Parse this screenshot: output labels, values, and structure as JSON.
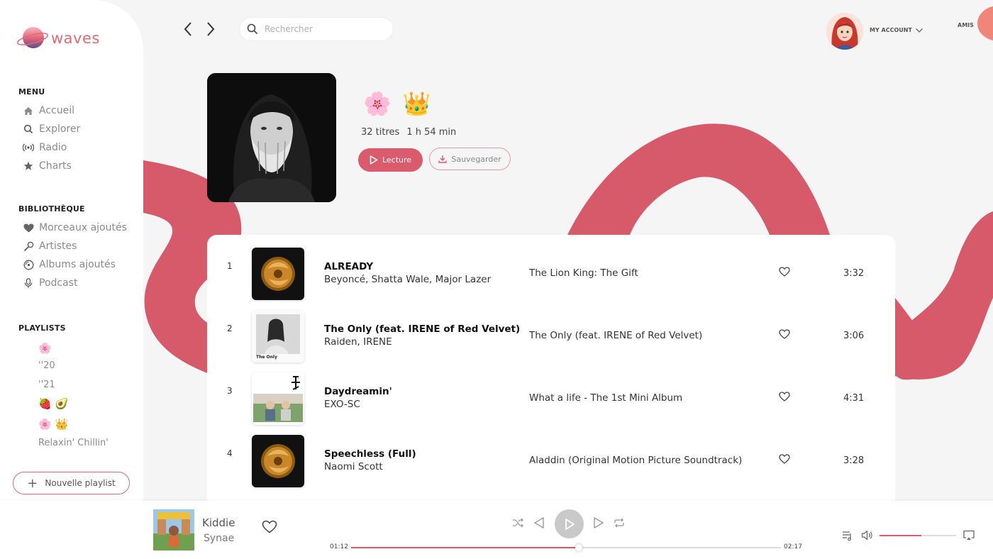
{
  "app": {
    "logo_text": "waves",
    "accent": "#d95b6c"
  },
  "search": {
    "placeholder": "Rechercher"
  },
  "account": {
    "label": "MY ACCOUNT",
    "friends_label": "AMIS"
  },
  "sidebar": {
    "menu_title": "MENU",
    "menu": [
      {
        "label": "Accueil",
        "icon": "home-icon"
      },
      {
        "label": "Explorer",
        "icon": "search-icon"
      },
      {
        "label": "Radio",
        "icon": "radio-icon"
      },
      {
        "label": "Charts",
        "icon": "star-icon"
      }
    ],
    "library_title": "BIBLIOTHÈQUE",
    "library": [
      {
        "label": "Morceaux ajoutés",
        "icon": "heart-icon"
      },
      {
        "label": "Artistes",
        "icon": "microphone-icon"
      },
      {
        "label": "Albums ajoutés",
        "icon": "disc-icon"
      },
      {
        "label": "Podcast",
        "icon": "podcast-mic-icon"
      }
    ],
    "playlists_title": "PLAYLISTS",
    "playlists": [
      {
        "label": "",
        "emoji": [
          "🌸"
        ]
      },
      {
        "label": "''20"
      },
      {
        "label": "''21"
      },
      {
        "label": "",
        "emoji": [
          "🍓",
          "🥑"
        ]
      },
      {
        "label": "",
        "emoji": [
          "🌸",
          "👑"
        ]
      },
      {
        "label": "Relaxin' Chillin'"
      }
    ],
    "new_playlist": "Nouvelle playlist"
  },
  "playlist": {
    "emoji": [
      "🌸",
      "👑"
    ],
    "track_count": "32 titres",
    "duration": "1 h 54 min",
    "play_label": "Lecture",
    "save_label": "Sauvegarder"
  },
  "tracks": [
    {
      "num": "1",
      "title": "ALREADY",
      "artist": "Beyoncé, Shatta Wale, Major Lazer",
      "album": "The Lion King: The Gift",
      "duration": "3:32"
    },
    {
      "num": "2",
      "title": "The Only (feat. IRENE of Red Velvet)",
      "artist": "Raiden, IRENE",
      "album": "The Only (feat. IRENE of Red Velvet)",
      "duration": "3:06",
      "cover_caption": "The Only"
    },
    {
      "num": "3",
      "title": "Daydreamin'",
      "artist": "EXO-SC",
      "album": "What a life - The 1st Mini Album",
      "duration": "4:31"
    },
    {
      "num": "4",
      "title": "Speechless (Full)",
      "artist": "Naomi Scott",
      "album": "Aladdin (Original Motion Picture Soundtrack)",
      "duration": "3:28"
    }
  ],
  "player": {
    "title": "Kiddie",
    "artist": "Synae",
    "current_time": "01:12",
    "total_time": "02:17",
    "progress": 0.53,
    "volume": 0.55
  }
}
